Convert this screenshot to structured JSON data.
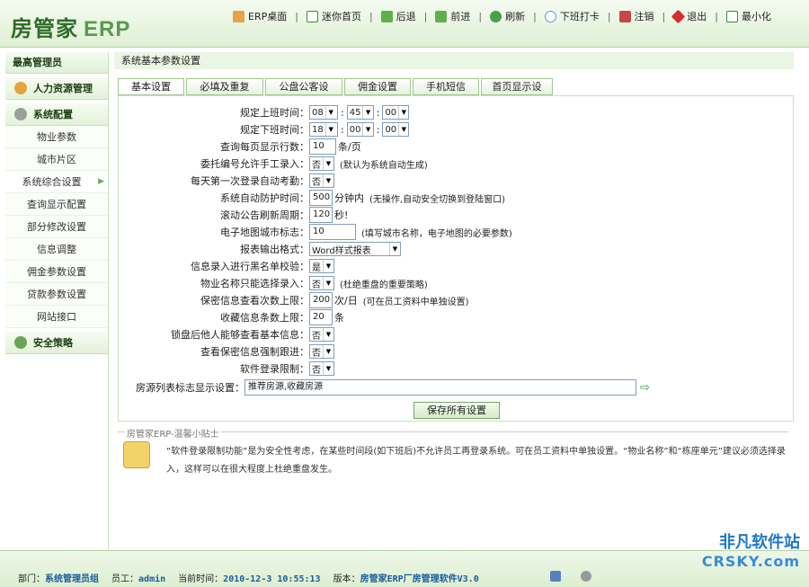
{
  "header": {
    "logo_cn": "房管家",
    "logo_en": "ERP",
    "toolbar": [
      {
        "label": "ERP桌面",
        "icon": "home-icon"
      },
      {
        "label": "迷你首页",
        "icon": "grid-icon"
      },
      {
        "label": "后退",
        "icon": "back-icon"
      },
      {
        "label": "前进",
        "icon": "forward-icon"
      },
      {
        "label": "刷新",
        "icon": "refresh-icon"
      },
      {
        "label": "下班打卡",
        "icon": "clock-icon"
      },
      {
        "label": "注销",
        "icon": "logout-icon"
      },
      {
        "label": "退出",
        "icon": "exit-icon"
      },
      {
        "label": "最小化",
        "icon": "minimize-icon"
      }
    ]
  },
  "sidebar": {
    "role": "最高管理员",
    "groups": {
      "hr": "人力资源管理",
      "config": "系统配置",
      "security": "安全策略"
    },
    "items": [
      "物业参数",
      "城市片区",
      "系统综合设置",
      "查询显示配置",
      "部分修改设置",
      "信息调整",
      "佣金参数设置",
      "贷款参数设置",
      "网站接口"
    ]
  },
  "main": {
    "breadcrumb": "系统基本参数设置",
    "tabs": [
      "基本设置",
      "必填及重复判定",
      "公盘公客设置",
      "佣金设置",
      "手机短信",
      "首页显示设置"
    ],
    "form": {
      "work_start": {
        "label": "规定上班时间：",
        "h": "08",
        "m": "45",
        "s": "00"
      },
      "work_end": {
        "label": "规定下班时间：",
        "h": "18",
        "m": "00",
        "s": "00"
      },
      "rows_per_page": {
        "label": "查询每页显示行数：",
        "value": "10",
        "suffix": "条/页"
      },
      "delegate_manual": {
        "label": "委托编号允许手工录入：",
        "value": "否",
        "note": "(默认为系统自动生成)"
      },
      "auto_attend": {
        "label": "每天第一次登录自动考勤：",
        "value": "否"
      },
      "auto_protect": {
        "label": "系统自动防护时间：",
        "value": "500",
        "suffix": "分钟内",
        "note": "(无操作,自动安全切换到登陆窗口)"
      },
      "scroll_refresh": {
        "label": "滚动公告刷新周期：",
        "value": "120",
        "suffix": "秒!"
      },
      "map_city": {
        "label": "电子地图城市标志：",
        "value": "10",
        "note": "(填写城市名称，电子地图的必要参数)"
      },
      "report_format": {
        "label": "报表输出格式：",
        "value": "Word样式报表"
      },
      "blacklist_check": {
        "label": "信息录入进行黑名单校验：",
        "value": "是"
      },
      "property_select": {
        "label": "物业名称只能选择录入：",
        "value": "否",
        "note": "(杜绝重盘的重要策略)"
      },
      "secret_view": {
        "label": "保密信息查看次数上限：",
        "value": "200",
        "suffix": "次/日",
        "note": "(可在员工资料中单独设置)"
      },
      "fav_limit": {
        "label": "收藏信息条数上限：",
        "value": "20",
        "suffix": "条"
      },
      "locked_view": {
        "label": "锁盘后他人能够查看基本信息：",
        "value": "否"
      },
      "secret_followup": {
        "label": "查看保密信息强制跟进：",
        "value": "否"
      },
      "login_limit": {
        "label": "软件登录限制：",
        "value": "否"
      },
      "list_flag": {
        "label": "房源列表标志显示设置：",
        "value": "推荐房源,收藏房源"
      }
    },
    "save_label": "保存所有设置",
    "tips": {
      "title": "房管家ERP-温馨小贴士",
      "text": "“软件登录限制功能”是为安全性考虑，在某些时间段(如下班后)不允许员工再登录系统。可在员工资料中单独设置。“物业名称”和“栋座单元”建议必须选择录入，这样可以在很大程度上杜绝重盘发生。"
    }
  },
  "footer": {
    "dept_label": "部门：",
    "dept": "系统管理员组",
    "staff_label": "员工：",
    "staff": "admin",
    "time_label": "当前时间：",
    "time": "2010-12-3 10:55:13",
    "version_label": "版本：",
    "version": "房管家ERP厂房管理软件V3.0",
    "watermark_1": "非凡软件站",
    "watermark_2": "CRSKY.com"
  },
  "colors": {
    "accent": "#2f6b2a",
    "panel_border": "#c9e2bb",
    "link_blue": "#1a5b9a"
  }
}
